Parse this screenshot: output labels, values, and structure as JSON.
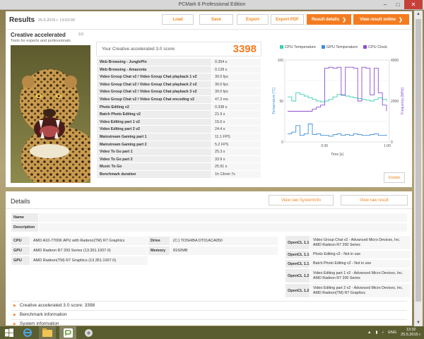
{
  "window": {
    "title": "PCMark 8 Professional Edition",
    "minimize": "–",
    "maximize": "□",
    "close": "✕"
  },
  "header": {
    "title": "Results",
    "date": "25.5.2015 г. 13:03:00",
    "buttons": {
      "load": "Load",
      "save": "Save",
      "export": "Export",
      "export_pdf": "Export PDF",
      "result_details": "Result details",
      "view_online": "View result online"
    },
    "chevron": "❯"
  },
  "benchmark": {
    "name": "Creative accelerated",
    "version": "3.0",
    "description": "Tests for experts and professionals",
    "score_label": "Your Creative accelerated 3.0 score",
    "score": "3398"
  },
  "results": [
    {
      "name": "Web Browsing - JunglePin",
      "value": "0.354 s"
    },
    {
      "name": "Web Browsing - Amazonia",
      "value": "0.128 s"
    },
    {
      "name": "Video Group Chat v2 / Video Group Chat playback 1 v2",
      "value": "30.0 fps"
    },
    {
      "name": "Video Group Chat v2 / Video Group Chat playback 2 v2",
      "value": "30.0 fps"
    },
    {
      "name": "Video Group Chat v2 / Video Group Chat playback 3 v2",
      "value": "30.0 fps"
    },
    {
      "name": "Video Group Chat v2 / Video Group Chat encoding v2",
      "value": "47.3 ms"
    },
    {
      "name": "Photo Editing v2",
      "value": "0.338 s"
    },
    {
      "name": "Batch Photo Editing v2",
      "value": "21.9 s"
    },
    {
      "name": "Video Editing part 1 v2",
      "value": "15.0 s"
    },
    {
      "name": "Video Editing part 2 v2",
      "value": "24.4 s"
    },
    {
      "name": "Mainstream Gaming part 1",
      "value": "11.1 FPS"
    },
    {
      "name": "Mainstream Gaming part 2",
      "value": "5.2 FPS"
    },
    {
      "name": "Video To Go part 1",
      "value": "25.3 s"
    },
    {
      "name": "Video To Go part 2",
      "value": "33.9 s"
    },
    {
      "name": "Music To Go",
      "value": "25.91 s"
    },
    {
      "name": "Benchmark duration",
      "value": "1h 13min 7s"
    }
  ],
  "chart": {
    "legend": [
      "CPU Temperature",
      "GPU Temperature",
      "CPU Clock"
    ],
    "colors": {
      "cpu_temp": "#3ccfb4",
      "gpu_temp": "#3d8fd6",
      "cpu_clock": "#8b4fcf",
      "accent": "#f47c20"
    },
    "y_left_label": "Temperature [°C]",
    "y_right_label": "Frequency [MHz]",
    "x_label": "Time [s]",
    "y_left_ticks": [
      "100",
      "50",
      "0"
    ],
    "y_right_ticks": [
      "4000",
      "2000",
      "0"
    ],
    "x_ticks": [
      "0:30",
      "1:00"
    ],
    "details_button": "Details"
  },
  "chart_data": {
    "type": "line",
    "x_label": "Time [s]",
    "y_left_label": "Temperature [°C]",
    "y_right_label": "Frequency [MHz]",
    "x_ticks": [
      "0:30",
      "1:00"
    ],
    "y_left_range": [
      0,
      100
    ],
    "y_right_range": [
      0,
      4000
    ],
    "series": [
      {
        "name": "CPU Temperature",
        "axis": "left",
        "values": [
          55,
          50,
          60,
          58,
          56,
          54,
          52,
          50,
          49,
          50,
          52,
          55,
          58,
          57,
          56,
          55,
          54,
          53,
          52,
          51,
          50,
          52,
          54,
          52,
          50
        ]
      },
      {
        "name": "GPU Temperature",
        "axis": "left",
        "values": [
          10,
          12,
          20,
          8,
          10,
          22,
          9,
          10,
          8,
          8,
          7,
          9,
          10,
          8,
          9,
          8,
          10,
          9,
          8,
          8,
          9,
          10,
          8,
          8,
          9
        ]
      },
      {
        "name": "CPU Clock",
        "axis": "right",
        "values": [
          1500,
          1500,
          1500,
          1500,
          1500,
          1500,
          1600,
          1700,
          1800,
          3600,
          3650,
          3600,
          3650,
          2300,
          3650,
          3650,
          3600,
          2000,
          3650,
          3600,
          2300,
          3600,
          2400,
          1800,
          1500
        ]
      }
    ],
    "legend_position": "top"
  },
  "details": {
    "title": "Details",
    "view_systeminfo": "View raw SystemInfo",
    "view_result": "View raw result",
    "name_label": "Name",
    "description_label": "Description",
    "hw_left": [
      {
        "key": "CPU",
        "value": "AMD A10-7700K APU with Radeon(TM) R7 Graphics"
      },
      {
        "key": "GPU",
        "value": "AMD Radeon R7 200 Series (13.351.1007.0)"
      },
      {
        "key": "GPU",
        "value": "AMD Radeon(TM) R7 Graphics (13.351.1007.0)"
      }
    ],
    "hw_mid": [
      {
        "key": "Drive",
        "value": "(C:) TOSHIBA DT01ACA050"
      },
      {
        "key": "Memory",
        "value": "8192MB"
      }
    ],
    "opencl": [
      {
        "key": "OpenCL 1.1",
        "value": "Video Group Chat v2 - Advanced Micro Devices, Inc. AMD Radeon R7 200 Series"
      },
      {
        "key": "OpenCL 1.1",
        "value": "Photo Editing v2 - Not in use"
      },
      {
        "key": "OpenCL 1.1",
        "value": "Batch Photo Editing v2 - Not in use"
      },
      {
        "key": "OpenCL 1.2",
        "value": "Video Editing part 1 v2 - Advanced Micro Devices, Inc. AMD Radeon R7 200 Series"
      },
      {
        "key": "OpenCL 1.2",
        "value": "Video Editing part 2 v2 - Advanced Micro Devices, Inc. AMD Radeon(TM) R7 Graphics"
      }
    ],
    "expanders": [
      "Creative accelerated 3.0 score: 3398",
      "Benchmark information",
      "System information"
    ],
    "expander_arrow": "▶"
  },
  "scrollbar": {
    "up": "▲",
    "down": "▼"
  },
  "taskbar": {
    "language": "ENG",
    "time": "13:32",
    "date": "25.5.2015 г."
  }
}
